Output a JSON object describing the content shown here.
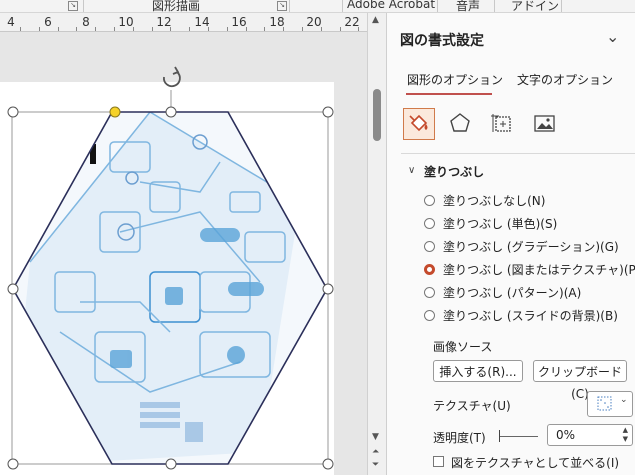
{
  "ribbon": {
    "group_drawing": "図形描画",
    "tab_acrobat": "Adobe Acrobat",
    "tab_audio": "音声",
    "tab_addin": "アドイン"
  },
  "ruler": {
    "ticks": [
      "4",
      "6",
      "8",
      "10",
      "12",
      "14",
      "16",
      "18",
      "20",
      "22"
    ]
  },
  "panel": {
    "title": "図の書式設定",
    "tabs": [
      {
        "label": "図形のオプション",
        "active": true
      },
      {
        "label": "文字のオプション",
        "active": false
      }
    ],
    "icons": [
      "fill-line-icon",
      "effects-pentagon-icon",
      "size-properties-icon",
      "picture-icon"
    ],
    "section": "塗りつぶし",
    "fill_options": [
      {
        "label": "塗りつぶしなし(N)",
        "selected": false
      },
      {
        "label": "塗りつぶし (単色)(S)",
        "selected": false
      },
      {
        "label": "塗りつぶし (グラデーション)(G)",
        "selected": false
      },
      {
        "label": "塗りつぶし (図またはテクスチャ)(P)",
        "selected": true
      },
      {
        "label": "塗りつぶし (パターン)(A)",
        "selected": false
      },
      {
        "label": "塗りつぶし (スライドの背景)(B)",
        "selected": false
      }
    ],
    "image_source_label": "画像ソース",
    "insert_button": "挿入する(R)...",
    "clipboard_button": "クリップボード(C)",
    "texture_label": "テクスチャ(U)",
    "transparency_label": "透明度(T)",
    "transparency_value": "0%",
    "transparency_fraction": 0,
    "tile_label": "図をテクスチャとして並べる(I)",
    "tile_checked": false
  },
  "colors": {
    "accent": "#c44a2c",
    "tab_underline": "#c0504d",
    "handle_yellow": "#f5d22a",
    "picture_blue": "#5aa4d8"
  }
}
